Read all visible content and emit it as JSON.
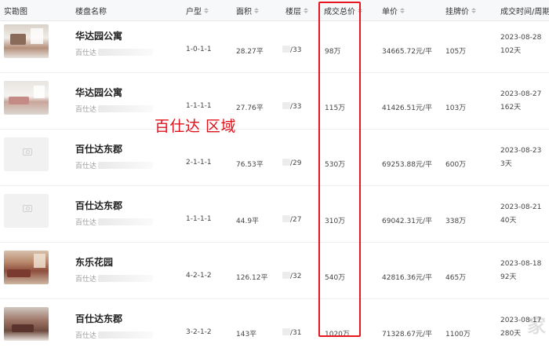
{
  "overlay": {
    "annotation": "百仕达 区域",
    "logo_text": "家"
  },
  "table": {
    "headers": [
      "实勘图",
      "楼盘名称",
      "户型",
      "面积",
      "楼层",
      "成交总价",
      "单价",
      "挂牌价",
      "成交时间/周期"
    ],
    "rows": [
      {
        "name": "华达园公寓",
        "sub": "百仕达",
        "layout": "1-0-1-1",
        "area": "28.27平",
        "floor": "/33",
        "total": "98万",
        "unit_price": "34665.72元/平",
        "list_price": "105万",
        "date": "2023-08-28",
        "cycle": "102天",
        "thumb_placeholder": false
      },
      {
        "name": "华达园公寓",
        "sub": "百仕达",
        "layout": "1-1-1-1",
        "area": "27.76平",
        "floor": "/33",
        "total": "115万",
        "unit_price": "41426.51元/平",
        "list_price": "103万",
        "date": "2023-08-27",
        "cycle": "162天",
        "thumb_placeholder": false
      },
      {
        "name": "百仕达东郡",
        "sub": "百仕达",
        "layout": "2-1-1-1",
        "area": "76.53平",
        "floor": "/29",
        "total": "530万",
        "unit_price": "69253.88元/平",
        "list_price": "600万",
        "date": "2023-08-23",
        "cycle": "3天",
        "thumb_placeholder": true
      },
      {
        "name": "百仕达东郡",
        "sub": "百仕达",
        "layout": "1-1-1-1",
        "area": "44.9平",
        "floor": "/27",
        "total": "310万",
        "unit_price": "69042.31元/平",
        "list_price": "338万",
        "date": "2023-08-21",
        "cycle": "40天",
        "thumb_placeholder": true
      },
      {
        "name": "东乐花园",
        "sub": "百仕达",
        "layout": "4-2-1-2",
        "area": "126.12平",
        "floor": "/32",
        "total": "540万",
        "unit_price": "42816.36元/平",
        "list_price": "465万",
        "date": "2023-08-18",
        "cycle": "92天",
        "thumb_placeholder": false
      },
      {
        "name": "百仕达东郡",
        "sub": "百仕达",
        "layout": "3-2-1-2",
        "area": "143平",
        "floor": "/31",
        "total": "1020万",
        "unit_price": "71328.67元/平",
        "list_price": "1100万",
        "date": "2023-08-17",
        "cycle": "280天",
        "thumb_placeholder": false
      }
    ]
  }
}
